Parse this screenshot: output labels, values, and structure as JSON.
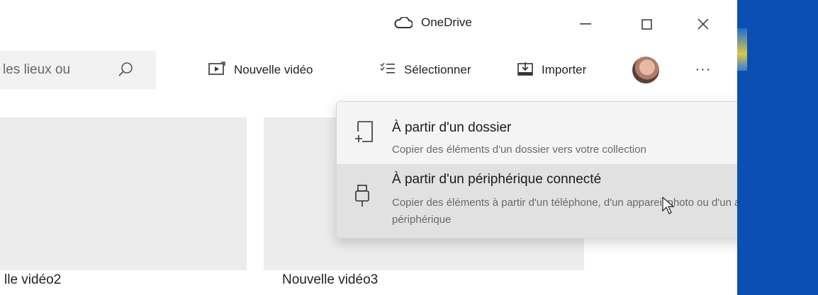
{
  "window": {
    "title": "OneDrive",
    "controls": {
      "minimize": "—",
      "maximize": "☐",
      "close": "✕"
    }
  },
  "toolbar": {
    "search_value": "les lieux ou",
    "new_video_label": "Nouvelle vidéo",
    "select_label": "Sélectionner",
    "import_label": "Importer",
    "more_label": "···"
  },
  "content": {
    "tiles": [
      {
        "caption": "lle vidéo2"
      },
      {
        "caption": "Nouvelle vidéo3"
      }
    ]
  },
  "import_menu": {
    "items": [
      {
        "title": "À partir d'un dossier",
        "description": "Copier des éléments d'un dossier vers votre collection",
        "icon": "folder-import-icon"
      },
      {
        "title": "À partir d'un périphérique connecté",
        "description": "Copier des éléments à partir d'un téléphone, d'un appareil photo ou d'un autre périphérique",
        "icon": "usb-device-icon",
        "highlighted": true
      }
    ]
  },
  "colors": {
    "desktop": "#0b4fb3",
    "menu_bg": "#f4f4f4",
    "menu_hover": "#e1e1e1",
    "tile_bg": "#ececec"
  }
}
